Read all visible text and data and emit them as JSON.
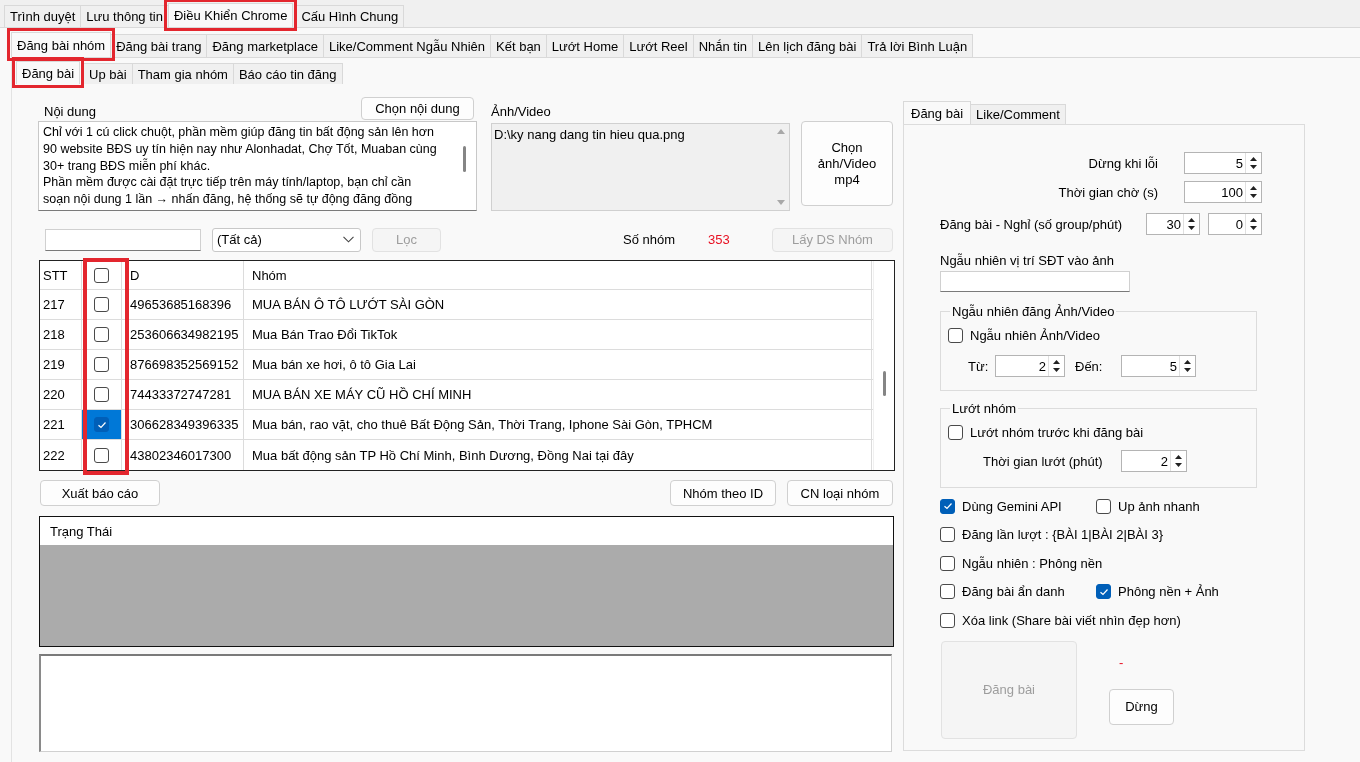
{
  "top_tabs": [
    {
      "label": "Trình duyệt",
      "selected": false,
      "highlighted": false
    },
    {
      "label": "Lưu thông tin",
      "selected": false,
      "highlighted": false
    },
    {
      "label": "Điều Khiển Chrome",
      "selected": true,
      "highlighted": true
    },
    {
      "label": "Cấu Hình Chung",
      "selected": false,
      "highlighted": false
    }
  ],
  "feature_tabs": [
    {
      "label": "Đăng bài nhóm",
      "selected": true,
      "highlighted": true
    },
    {
      "label": "Đăng bài trang",
      "selected": false,
      "highlighted": false
    },
    {
      "label": "Đăng marketplace",
      "selected": false,
      "highlighted": false
    },
    {
      "label": "Like/Comment Ngẫu Nhiên",
      "selected": false,
      "highlighted": false
    },
    {
      "label": "Kết bạn",
      "selected": false,
      "highlighted": false
    },
    {
      "label": "Lướt Home",
      "selected": false,
      "highlighted": false
    },
    {
      "label": "Lướt Reel",
      "selected": false,
      "highlighted": false
    },
    {
      "label": "Nhắn tin",
      "selected": false,
      "highlighted": false
    },
    {
      "label": "Lên lịch đăng bài",
      "selected": false,
      "highlighted": false
    },
    {
      "label": "Trả lời Bình Luận",
      "selected": false,
      "highlighted": false
    }
  ],
  "post_tabs": [
    {
      "label": "Đăng bài",
      "selected": true,
      "highlighted": true
    },
    {
      "label": "Up bài",
      "selected": false,
      "highlighted": false
    },
    {
      "label": "Tham gia nhóm",
      "selected": false,
      "highlighted": false
    },
    {
      "label": "Báo cáo tin đăng",
      "selected": false,
      "highlighted": false
    }
  ],
  "content": {
    "label": "Nội dung",
    "choose_button": "Chọn nội dung",
    "lines": [
      "Chỉ với 1 cú click chuột, phần mềm giúp đăng tin bất động sản lên hơn",
      "90 website BĐS uy tín hiện nay như Alonhadat, Chợ Tốt, Muaban cùng",
      "30+ trang BĐS miễn phí khác.",
      "Phần mềm được cài đặt trực tiếp trên máy tính/laptop, bạn chỉ cần",
      "soạn nội dung 1 lần → nhấn đăng, hệ thống sẽ tự động đăng đồng"
    ]
  },
  "media": {
    "label": "Ảnh/Video",
    "files": [
      "D:\\ky nang dang tin hieu qua.png"
    ],
    "choose_button": "Chọn ảnh/Video mp4"
  },
  "filter": {
    "category": "(Tất cả)",
    "filter_button": {
      "label": "Lọc",
      "disabled": true
    },
    "count_label": "Số nhóm",
    "count": "353",
    "fetch_button": {
      "label": "Lấy DS Nhóm",
      "disabled": true
    }
  },
  "table": {
    "columns": [
      {
        "kind": "text",
        "label": "STT",
        "highlighted": false
      },
      {
        "kind": "checkbox",
        "checked": false,
        "highlighted": true
      },
      {
        "kind": "text",
        "label": "D",
        "highlighted": false
      },
      {
        "kind": "text",
        "label": "Nhóm",
        "highlighted": false
      }
    ],
    "rows": [
      {
        "cells": [
          "217",
          "",
          "49653685168396",
          "MUA BÁN Ô TÔ LƯỚT SÀI GÒN"
        ],
        "checked": false,
        "selected": false
      },
      {
        "cells": [
          "218",
          "",
          "253606634982195",
          "Mua Bán Trao Đổi TikTok"
        ],
        "checked": false,
        "selected": false
      },
      {
        "cells": [
          "219",
          "",
          "876698352569152",
          "Mua bán xe hơi, ô tô Gia Lai"
        ],
        "checked": false,
        "selected": false
      },
      {
        "cells": [
          "220",
          "",
          "74433372747281",
          "MUA BÁN XE MÁY CŨ HỒ CHÍ MINH"
        ],
        "checked": false,
        "selected": false
      },
      {
        "cells": [
          "221",
          "",
          "306628349396335",
          "Mua bán, rao vặt, cho thuê Bất Động Sản, Thời Trang, Iphone Sài Gòn, TPHCM"
        ],
        "checked": true,
        "selected": true
      },
      {
        "cells": [
          "222",
          "",
          "43802346017300",
          "Mua bất động sản TP Hồ Chí Minh, Bình Dương, Đồng Nai tại đây"
        ],
        "checked": false,
        "selected": false
      }
    ]
  },
  "actions": {
    "export_button": "Xuất báo cáo",
    "group_by_id_button": "Nhóm theo ID",
    "update_type_button": "CN loại nhóm"
  },
  "status_list": {
    "header": "Trạng Thái"
  },
  "settings": {
    "tabs": [
      {
        "label": "Đăng bài",
        "selected": true
      },
      {
        "label": "Like/Comment",
        "selected": false
      }
    ],
    "limits": [
      {
        "label": "Dừng khi lỗi",
        "value": "5"
      },
      {
        "label": "Thời gian chờ (s)",
        "value": "100"
      }
    ],
    "rest": {
      "label": "Đăng bài - Nghỉ (số group/phút)",
      "values": [
        "30",
        "0"
      ]
    },
    "phone_position": {
      "label": "Ngẫu nhiên vị trí SĐT vào ảnh"
    },
    "random_media": {
      "title": "Ngẫu nhiên đăng Ảnh/Video",
      "option": {
        "label": "Ngẫu nhiên Ảnh/Video",
        "checked": false
      },
      "from_label": "Từ:",
      "from_value": "2",
      "to_label": "Đến:",
      "to_value": "5"
    },
    "scroll_groups": {
      "title": "Lướt nhóm",
      "option": {
        "label": "Lướt nhóm trước khi đăng bài",
        "checked": false
      },
      "duration_label": "Thời gian lướt (phút)",
      "duration_value": "2"
    },
    "options": [
      {
        "items": [
          {
            "label": "Dùng Gemini API",
            "checked": true
          },
          {
            "label": "Up ảnh nhanh",
            "checked": false
          }
        ]
      },
      {
        "items": [
          {
            "label": "Đăng lần lượt : {BÀI 1|BÀI 2|BÀI 3}",
            "checked": false
          }
        ]
      },
      {
        "items": [
          {
            "label": "Ngẫu nhiên : Phông nền",
            "checked": false
          }
        ]
      },
      {
        "items": [
          {
            "label": "Đăng bài ẩn danh",
            "checked": false
          },
          {
            "label": "Phông nền + Ảnh",
            "checked": true
          }
        ]
      },
      {
        "items": [
          {
            "label": "Xóa link (Share bài viết nhìn đẹp hơn)",
            "checked": false
          }
        ]
      }
    ],
    "post_button": {
      "label": "Đăng bài",
      "disabled": true
    },
    "status_text": "-",
    "stop_button": "Dừng"
  }
}
